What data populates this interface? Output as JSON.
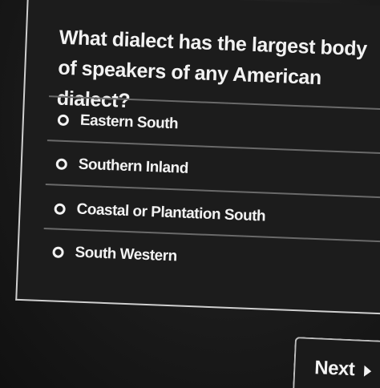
{
  "question": {
    "text": "What dialect has the largest body of speakers of any American dialect?"
  },
  "options": [
    {
      "label": "Eastern South",
      "selected": false
    },
    {
      "label": "Southern Inland",
      "selected": false
    },
    {
      "label": "Coastal or Plantation South",
      "selected": false
    },
    {
      "label": "South Western",
      "selected": false
    }
  ],
  "navigation": {
    "next_label": "Next",
    "next_icon": "play-arrow-icon"
  }
}
